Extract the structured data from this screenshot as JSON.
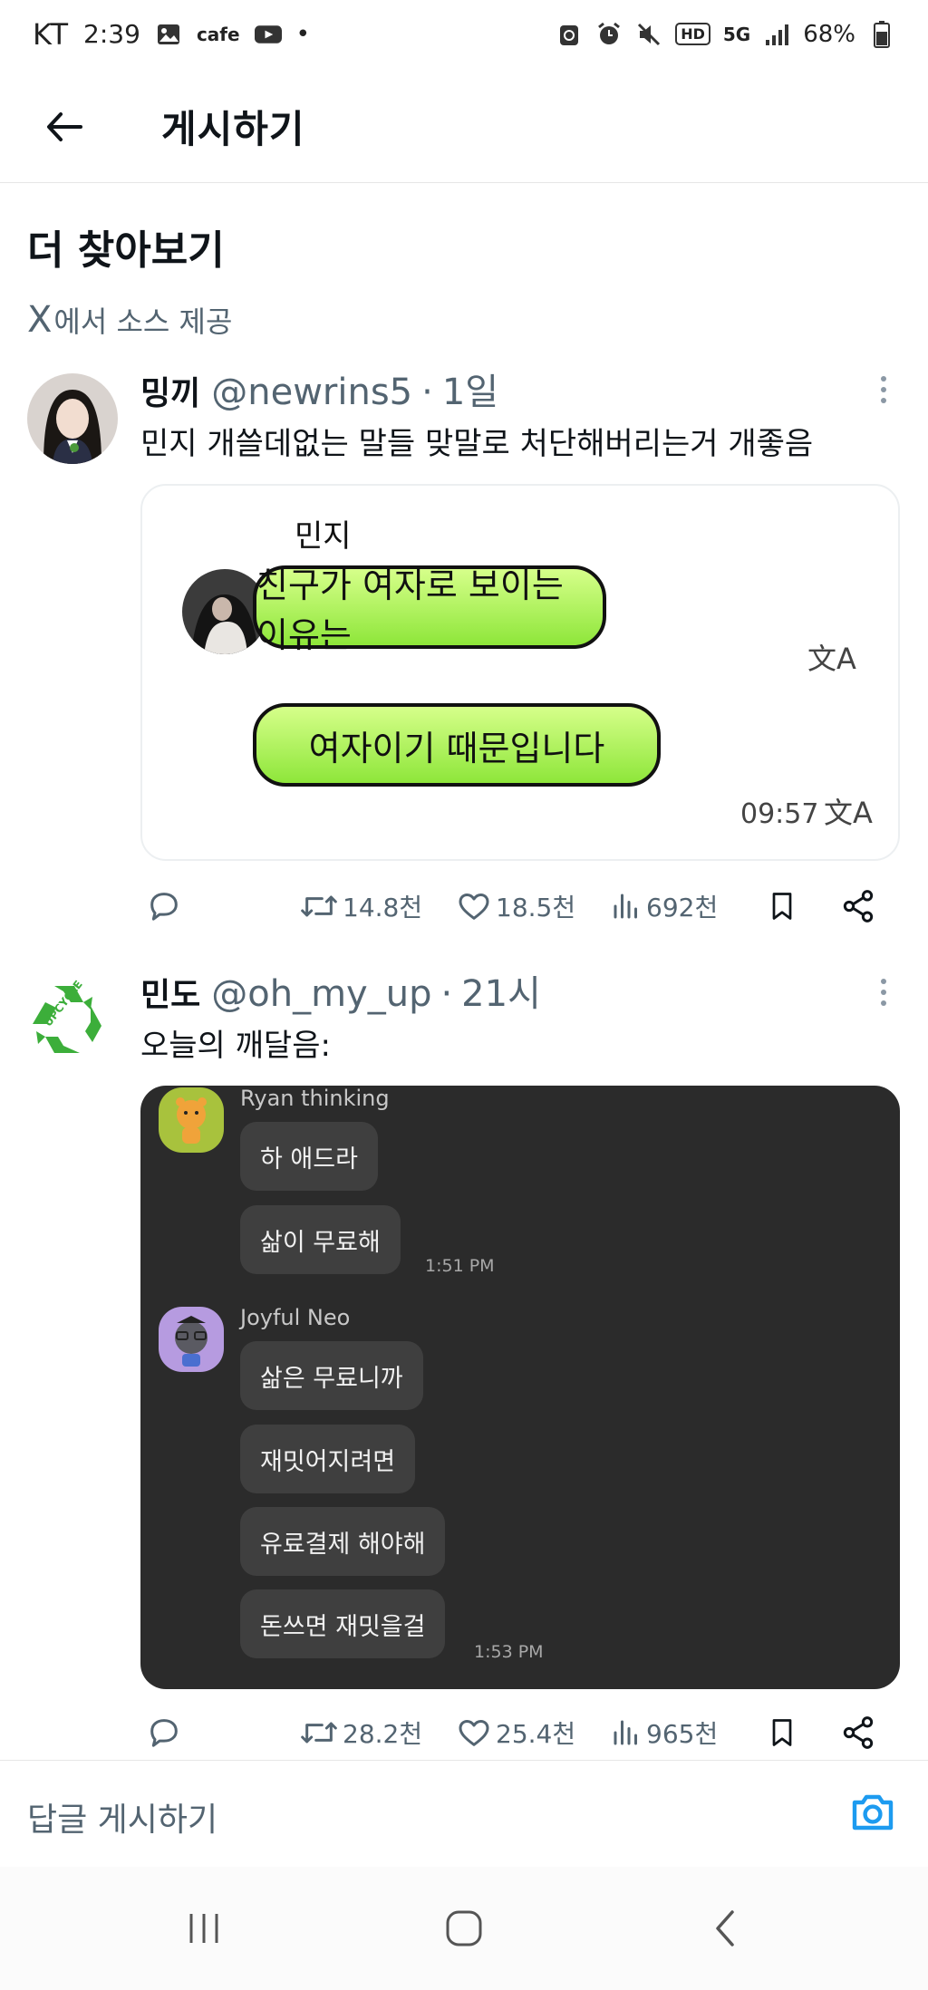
{
  "status_bar": {
    "carrier": "KT",
    "time": "2:39",
    "cafe_label": "cafe",
    "dot": "•",
    "hd_label": "HD",
    "network_label": "5G",
    "battery": "68%"
  },
  "header": {
    "title": "게시하기"
  },
  "section": {
    "title": "더 찾아보기",
    "source_x": "X",
    "source_text": "에서 소스 제공"
  },
  "tweets": [
    {
      "name": "밍끼",
      "handle": "@newrins5",
      "dot": "·",
      "time": "1일",
      "text": "민지 개쓸데없는 말들 맞말로 처단해버리는거 개좋음",
      "media": {
        "sender": "민지",
        "bubble1": "친구가 여자로 보이는 이유는",
        "bubble2": "여자이기 때문입니다",
        "time": "09:57",
        "translate_glyph": "文A"
      },
      "stats": {
        "retweets": "14.8천",
        "likes": "18.5천",
        "views": "692천"
      }
    },
    {
      "name": "민도",
      "handle": "@oh_my_up",
      "dot": "·",
      "time": "21시",
      "text": "오늘의 깨달음:",
      "avatar_text": "UPCYCLE",
      "media": {
        "sender1": "Ryan thinking",
        "msg1": "하 애드라",
        "msg2": "삶이 무료해",
        "time1": "1:51 PM",
        "sender2": "Joyful Neo",
        "msg3": "삶은 무료니까",
        "msg4": "재밋어지려면",
        "msg5": "유료결제 해야해",
        "msg6": "돈쓰면 재밋을걸",
        "time2": "1:53 PM"
      },
      "stats": {
        "retweets": "28.2천",
        "likes": "25.4천",
        "views": "965천"
      }
    }
  ],
  "reply": {
    "placeholder": "답글 게시하기"
  },
  "colors": {
    "accent": "#1d9bf0",
    "muted": "#536471",
    "bubble_green": "#9be84a",
    "dark_chat_bg": "#2b2b2b",
    "recycle_green": "#3cae3a"
  }
}
